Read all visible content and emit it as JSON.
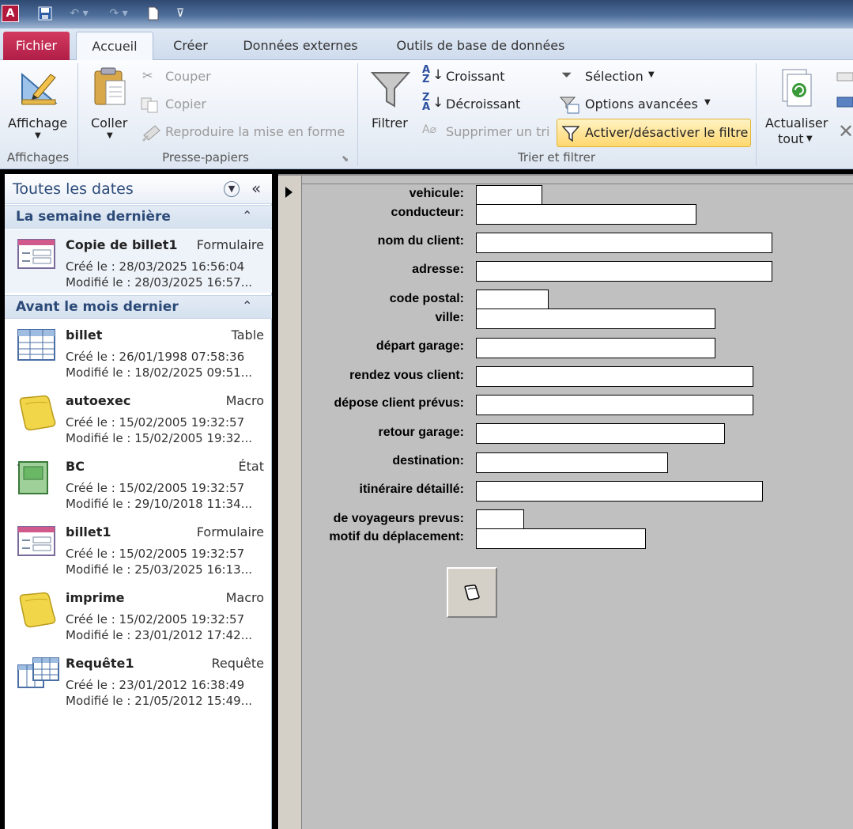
{
  "quick_access": {
    "logo": "A"
  },
  "tabs": {
    "fichier": "Fichier",
    "accueil": "Accueil",
    "creer": "Créer",
    "donnees_externes": "Données externes",
    "outils": "Outils de base de données"
  },
  "ribbon": {
    "affichage": "Affichage",
    "affichages_group": "Affichages",
    "coller": "Coller",
    "couper": "Couper",
    "copier": "Copier",
    "reproduire": "Reproduire la mise en forme",
    "presse_papiers_group": "Presse-papiers",
    "filtrer": "Filtrer",
    "croissant": "Croissant",
    "decroissant": "Décroissant",
    "supprimer_tri": "Supprimer un tri",
    "selection": "Sélection",
    "options_avancees": "Options avancées",
    "activer_filtre": "Activer/désactiver le filtre",
    "trier_filtrer_group": "Trier et filtrer",
    "actualiser_line1": "Actualiser",
    "actualiser_line2": "tout"
  },
  "nav": {
    "title": "Toutes les dates",
    "groups": [
      {
        "title": "La semaine dernière",
        "items": [
          {
            "name": "Copie de billet1",
            "type": "Formulaire",
            "created": "Créé le : 28/03/2025 16:56:04",
            "modified": "Modifié le : 28/03/2025 16:57..."
          }
        ]
      },
      {
        "title": "Avant le mois dernier",
        "items": [
          {
            "name": "billet",
            "type": "Table",
            "created": "Créé le : 26/01/1998 07:58:36",
            "modified": "Modifié le : 18/02/2025 09:51..."
          },
          {
            "name": "autoexec",
            "type": "Macro",
            "created": "Créé le : 15/02/2005 19:32:57",
            "modified": "Modifié le : 15/02/2005 19:32..."
          },
          {
            "name": "BC",
            "type": "État",
            "created": "Créé le : 15/02/2005 19:32:57",
            "modified": "Modifié le : 29/10/2018 11:34..."
          },
          {
            "name": "billet1",
            "type": "Formulaire",
            "created": "Créé le : 15/02/2005 19:32:57",
            "modified": "Modifié le : 25/03/2025 16:13..."
          },
          {
            "name": "imprime",
            "type": "Macro",
            "created": "Créé le : 15/02/2005 19:32:57",
            "modified": "Modifié le : 23/01/2012 17:42..."
          },
          {
            "name": "Requête1",
            "type": "Requête",
            "created": "Créé le : 23/01/2012 16:38:49",
            "modified": "Modifié le : 21/05/2012 15:49..."
          }
        ]
      }
    ]
  },
  "form": {
    "fields": [
      {
        "label": "vehicule:",
        "value": ""
      },
      {
        "label": "conducteur:",
        "value": ""
      },
      {
        "label": "nom du client:",
        "value": ""
      },
      {
        "label": "adresse:",
        "value": ""
      },
      {
        "label": "code postal:",
        "value": ""
      },
      {
        "label": "ville:",
        "value": ""
      },
      {
        "label": "départ garage:",
        "value": ""
      },
      {
        "label": "rendez vous client:",
        "value": ""
      },
      {
        "label": "dépose client prévus:",
        "value": ""
      },
      {
        "label": "retour garage:",
        "value": ""
      },
      {
        "label": "destination:",
        "value": ""
      },
      {
        "label": "itinéraire détaillé:",
        "value": ""
      },
      {
        "label": "de voyageurs prevus:",
        "value": ""
      },
      {
        "label": "motif du déplacement:",
        "value": ""
      }
    ]
  }
}
